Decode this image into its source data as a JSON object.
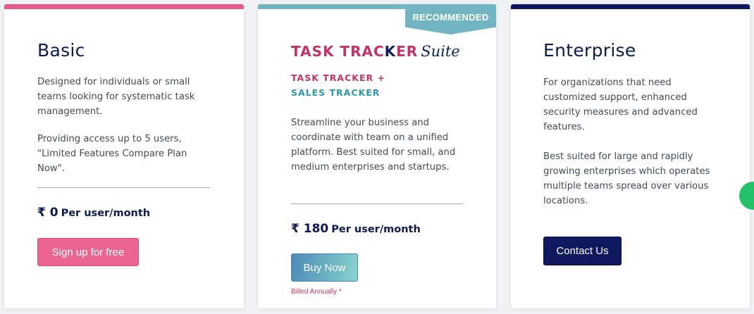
{
  "colors": {
    "basic_accent": "#e45c8a",
    "suite_accent": "#71b5c3",
    "enterprise_accent": "#0e1660",
    "logo_pink": "#c23466",
    "logo_navy": "#14205a",
    "logo_teal": "#2a9aa6"
  },
  "plans": {
    "basic": {
      "title": "Basic",
      "desc_lines": [
        "Designed for individuals or small",
        "teams looking for systematic task",
        "management."
      ],
      "desc2_lines": [
        "Providing access up to 5 users,",
        "\"Limited Features Compare Plan",
        "Now\"."
      ],
      "price": "₹ 0",
      "price_unit": "Per user/month",
      "cta": "Sign up for free"
    },
    "suite": {
      "ribbon": "RECOMMENDED",
      "logo_task": "TASK TRAC",
      "logo_k": "K",
      "logo_er": "ER",
      "logo_suite": "Suite",
      "sub1": "TASK TRACKER +",
      "sub2": "SALES TRACKER",
      "desc_lines": [
        "Streamline your business and",
        "coordinate with team on a unified",
        "platform. Best suited for small, and",
        "medium enterprises and startups."
      ],
      "price": "₹ 180",
      "price_unit": "Per user/month",
      "cta": "Buy Now",
      "billing_note": "Billed Annually *"
    },
    "enterprise": {
      "title": "Enterprise",
      "desc_lines": [
        "For organizations that need",
        "customized support, enhanced",
        "security measures and advanced",
        "features."
      ],
      "desc2_lines": [
        "Best suited for large and rapidly",
        "growing enterprises which operates",
        "multiple teams spread over various",
        "locations."
      ],
      "cta": "Contact Us"
    }
  }
}
